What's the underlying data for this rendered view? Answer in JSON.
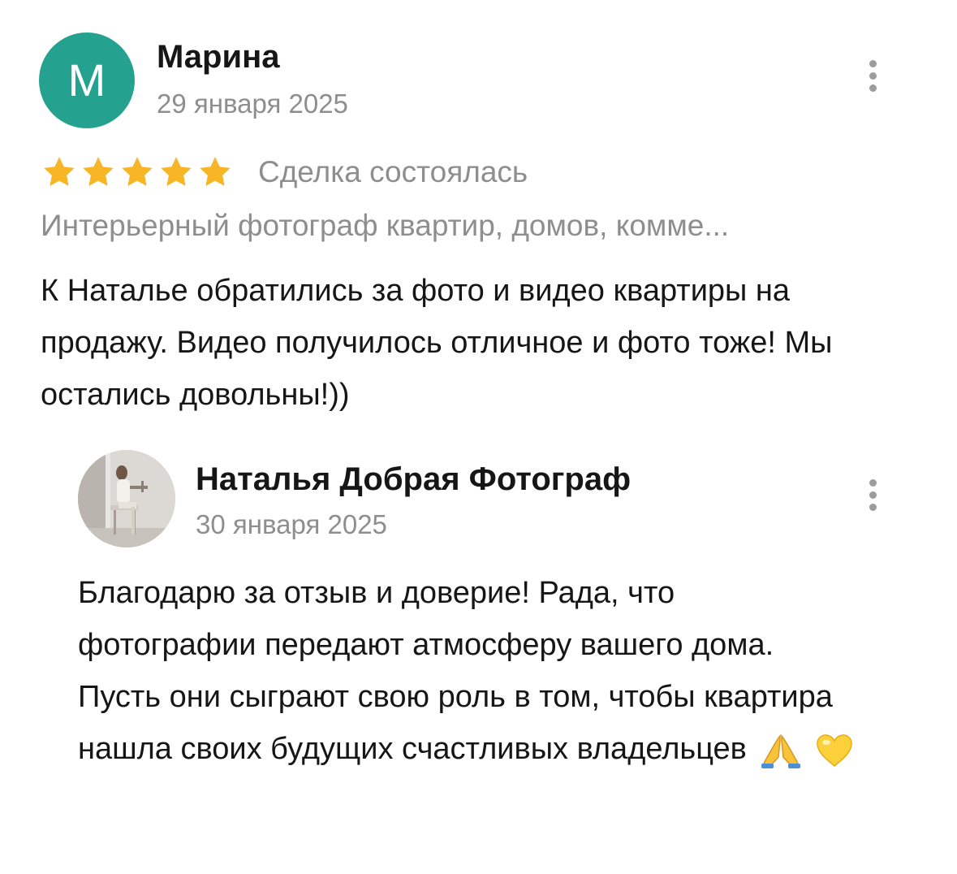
{
  "review": {
    "avatar_letter": "М",
    "avatar_color": "#24a28f",
    "author": "Марина",
    "date": "29 января 2025",
    "rating": 5,
    "rating_max": 5,
    "star_color": "#f8b526",
    "status": "Сделка состоялась",
    "service": "Интерьерный фотограф квартир, домов, комме...",
    "text": "К Наталье обратились за фото и видео квартиры на продажу. Видео получилось отличное и фото тоже! Мы остались довольны!))",
    "menu_icon": "more-vertical-icon"
  },
  "reply": {
    "author": "Наталья Добрая Фотограф",
    "date": "30 января 2025",
    "text": "Благодарю за отзыв и доверие! Рада, что фотографии передают атмосферу вашего дома. Пусть они сыграют свою роль в том, чтобы квартира нашла своих будущих счастливых владельцев",
    "emojis": [
      "pray-emoji",
      "yellow-heart-emoji"
    ],
    "menu_icon": "more-vertical-icon"
  }
}
